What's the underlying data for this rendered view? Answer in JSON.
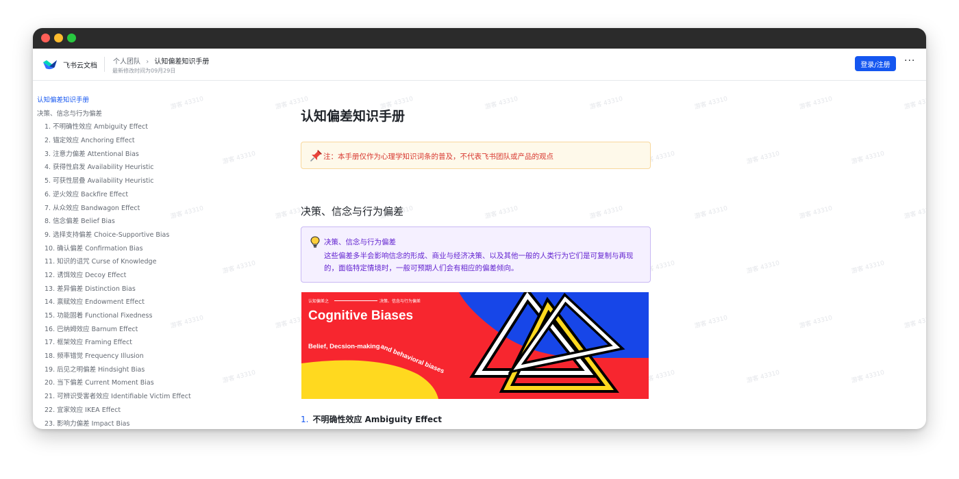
{
  "header": {
    "app_name": "飞书云文档",
    "breadcrumb_parent": "个人团队",
    "breadcrumb_current": "认知偏差知识手册",
    "modified": "最新修改时间为09月29日",
    "login_label": "登录/注册",
    "more_label": "···"
  },
  "watermark_text": "游客 43310",
  "toc": {
    "items": [
      {
        "label": "认知偏差知识手册",
        "active": true
      },
      {
        "label": "决策、信念与行为偏差"
      },
      {
        "label": "1. 不明确性效应 Ambiguity Effect",
        "sub": true
      },
      {
        "label": "2. 锚定效应 Anchoring Effect",
        "sub": true
      },
      {
        "label": "3. 注意力偏差 Attentional Bias",
        "sub": true
      },
      {
        "label": "4. 获得性启发 Availability Heuristic",
        "sub": true
      },
      {
        "label": "5. 可获性层叠 Availability Heuristic",
        "sub": true
      },
      {
        "label": "6. 逆火效应 Backfire Effect",
        "sub": true
      },
      {
        "label": "7. 从众效应 Bandwagon Effect",
        "sub": true
      },
      {
        "label": "8. 信念偏差 Belief Bias",
        "sub": true
      },
      {
        "label": "9. 选择支持偏差 Choice-Supportive Bias",
        "sub": true
      },
      {
        "label": "10. 确认偏差 Confirmation Bias",
        "sub": true
      },
      {
        "label": "11. 知识的诅咒 Curse of Knowledge",
        "sub": true
      },
      {
        "label": "12. 诱饵效应 Decoy Effect",
        "sub": true
      },
      {
        "label": "13. 差异偏差 Distinction Bias",
        "sub": true
      },
      {
        "label": "14. 禀赋效应 Endowment Effect",
        "sub": true
      },
      {
        "label": "15. 功能固着 Functional Fixedness",
        "sub": true
      },
      {
        "label": "16. 巴纳姆效应 Barnum Effect",
        "sub": true
      },
      {
        "label": "17. 框架效应 Framing Effect",
        "sub": true
      },
      {
        "label": "18. 频率错觉 Frequency Illusion",
        "sub": true
      },
      {
        "label": "19. 后见之明偏差 Hindsight Bias",
        "sub": true
      },
      {
        "label": "20. 当下偏差 Current Moment Bias",
        "sub": true
      },
      {
        "label": "21. 可辨识受害者效应 Identifiable Victim Effect",
        "sub": true
      },
      {
        "label": "22. 宜家效应 IKEA Effect",
        "sub": true
      },
      {
        "label": "23. 影响力偏差 Impact Bias",
        "sub": true
      }
    ]
  },
  "doc": {
    "title": "认知偏差知识手册",
    "note": "注：本手册仅作为心理学知识词条的普及，不代表飞书团队或产品的观点",
    "section_heading": "决策、信念与行为偏差",
    "callout_title": "决策、信念与行为偏差",
    "callout_body": "这些偏差多半会影响信念的形成、商业与经济决策、以及其他一般的人类行为它们是可复制与再现的，面临特定情境时，一般可预期人们会有相应的偏差倾向。",
    "banner": {
      "top_left": "认知偏差之",
      "top_right": "决策、信念与行为偏差",
      "title": "Cognitive Biases",
      "subtitle": "Belief, Decsion-making and behavioral biases"
    },
    "first_entry_number": "1.",
    "first_entry_title": "不明确性效应 Ambiguity Effect"
  },
  "colors": {
    "accent": "#1456f0",
    "note_text": "#d83931",
    "callout_text": "#6425d0",
    "banner_red": "#f7262f",
    "banner_blue": "#1746e8",
    "banner_yellow": "#ffd91f"
  }
}
